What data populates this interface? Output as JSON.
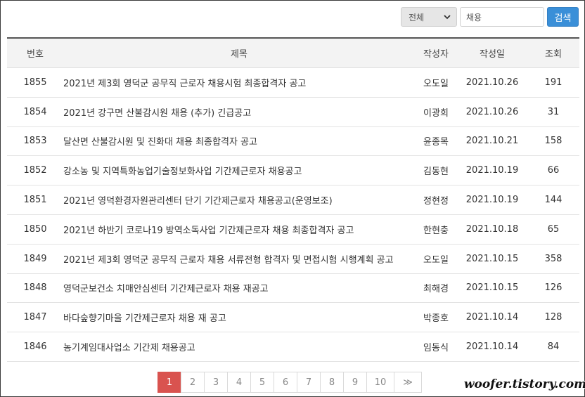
{
  "search": {
    "select_value": "전체",
    "input_value": "채용",
    "button_label": "검색"
  },
  "table": {
    "headers": {
      "no": "번호",
      "title": "제목",
      "author": "작성자",
      "date": "작성일",
      "views": "조회"
    },
    "rows": [
      {
        "no": "1855",
        "title": "2021년 제3회 영덕군 공무직 근로자 채용시험 최종합격자 공고",
        "author": "오도일",
        "date": "2021.10.26",
        "views": "191"
      },
      {
        "no": "1854",
        "title": "2021년 강구면 산불감시원 채용 (추가) 긴급공고",
        "author": "이광희",
        "date": "2021.10.26",
        "views": "31"
      },
      {
        "no": "1853",
        "title": "달산면 산불감시원 및 진화대 채용 최종합격자 공고",
        "author": "윤종목",
        "date": "2021.10.21",
        "views": "158"
      },
      {
        "no": "1852",
        "title": "강소농 및 지역특화농업기술정보화사업 기간제근로자 채용공고",
        "author": "김동현",
        "date": "2021.10.19",
        "views": "66"
      },
      {
        "no": "1851",
        "title": "2021년 영덕환경자원관리센터 단기 기간제근로자 채용공고(운영보조)",
        "author": "정현정",
        "date": "2021.10.19",
        "views": "144"
      },
      {
        "no": "1850",
        "title": "2021년 하반기 코로나19 방역소독사업 기간제근로자 채용 최종합격자 공고",
        "author": "한현충",
        "date": "2021.10.18",
        "views": "65"
      },
      {
        "no": "1849",
        "title": "2021년 제3회 영덕군 공무직 근로자 채용 서류전형 합격자 및 면접시험 시행계획 공고",
        "author": "오도일",
        "date": "2021.10.15",
        "views": "358"
      },
      {
        "no": "1848",
        "title": "영덕군보건소 치매안심센터 기간제근로자 채용 재공고",
        "author": "최해경",
        "date": "2021.10.15",
        "views": "126"
      },
      {
        "no": "1847",
        "title": "바다숲향기마을 기간제근로자 채용 재 공고",
        "author": "박종호",
        "date": "2021.10.14",
        "views": "128"
      },
      {
        "no": "1846",
        "title": "농기계임대사업소 기간제 채용공고",
        "author": "임동식",
        "date": "2021.10.14",
        "views": "84"
      }
    ]
  },
  "pagination": {
    "pages": [
      "1",
      "2",
      "3",
      "4",
      "5",
      "6",
      "7",
      "8",
      "9",
      "10"
    ],
    "current": "1",
    "next_label": "≫"
  },
  "watermark": "woofer.tistory.com",
  "colors": {
    "accent_button": "#3a8fd8",
    "active_page": "#d9534f"
  },
  "icons": {
    "select_arrow": "chevron-down-icon"
  }
}
